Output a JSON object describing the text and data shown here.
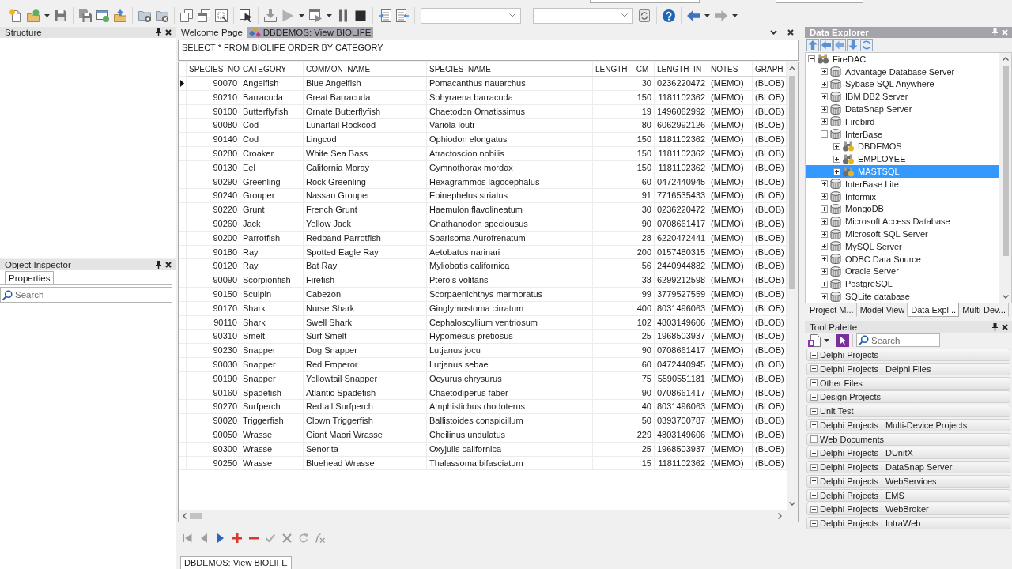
{
  "toolbar": {
    "groups": [
      {
        "buttons": [
          {
            "kind": "new_file",
            "disabled": false
          },
          {
            "kind": "open_folder",
            "disabled": false
          },
          {
            "kind": "menu_caret",
            "disabled": false
          },
          {
            "kind": "save",
            "disabled": false
          }
        ]
      },
      {
        "buttons": [
          {
            "kind": "save_all",
            "disabled": false
          },
          {
            "kind": "window_add",
            "disabled": false
          },
          {
            "kind": "folder_up",
            "disabled": false
          }
        ]
      },
      {
        "buttons": [
          {
            "kind": "folder_gear",
            "disabled": false
          },
          {
            "kind": "folder_remove",
            "disabled": false
          }
        ]
      },
      {
        "buttons": [
          {
            "kind": "page",
            "disabled": false
          },
          {
            "kind": "windows",
            "disabled": false
          },
          {
            "kind": "page_view",
            "disabled": false
          }
        ]
      },
      {
        "buttons": [
          {
            "kind": "toggle_form",
            "disabled": false
          }
        ]
      },
      {
        "buttons": [
          {
            "kind": "download",
            "disabled": false
          },
          {
            "kind": "run",
            "disabled": true
          },
          {
            "kind": "menu_caret",
            "disabled": false
          },
          {
            "kind": "run_window",
            "disabled": false
          },
          {
            "kind": "menu_caret",
            "disabled": false
          },
          {
            "kind": "pause",
            "disabled": false
          },
          {
            "kind": "stop",
            "disabled": false
          }
        ]
      },
      {
        "buttons": [
          {
            "kind": "list_left",
            "disabled": false
          },
          {
            "kind": "list_right",
            "disabled": false
          }
        ]
      },
      {
        "buttons": [
          {
            "kind": "combo",
            "disabled": false
          }
        ]
      },
      {
        "buttons": [
          {
            "kind": "combo",
            "disabled": false
          },
          {
            "kind": "page_sync",
            "disabled": false
          }
        ]
      },
      {
        "buttons": [
          {
            "kind": "help",
            "disabled": false
          }
        ]
      },
      {
        "buttons": [
          {
            "kind": "back",
            "disabled": false
          },
          {
            "kind": "menu_caret",
            "disabled": false
          },
          {
            "kind": "forward",
            "disabled": true
          },
          {
            "kind": "menu_caret",
            "disabled": false
          }
        ]
      }
    ]
  },
  "structure_panel": {
    "title": "Structure",
    "active": false
  },
  "object_inspector": {
    "title": "Object Inspector",
    "active": false,
    "tabs": [
      {
        "label": "Properties",
        "selected": true
      }
    ],
    "search": {
      "placeholder": "Search"
    }
  },
  "editor": {
    "tabs": [
      {
        "label": "Welcome Page",
        "kind": "welcome",
        "selected": false
      },
      {
        "label": "DBDEMOS: View BIOLIFE",
        "kind": "data_view",
        "selected": true
      }
    ],
    "sql": "SELECT * FROM BIOLIFE ORDER BY CATEGORY",
    "grid": {
      "columns": [
        "SPECIES_NO",
        "CATEGORY",
        "COMMON_NAME",
        "SPECIES_NAME",
        "LENGTH__CM_",
        "LENGTH_IN",
        "NOTES",
        "GRAPH"
      ],
      "rows": [
        {
          "selected": true,
          "cells": [
            "90070",
            "Angelfish",
            "Blue Angelfish",
            "Pomacanthus nauarchus",
            "30",
            "0236220472",
            "(MEMO)",
            "(BLOB)"
          ]
        },
        {
          "selected": false,
          "cells": [
            "90210",
            "Barracuda",
            "Great Barracuda",
            "Sphyraena barracuda",
            "150",
            "1181102362",
            "(MEMO)",
            "(BLOB)"
          ]
        },
        {
          "selected": false,
          "cells": [
            "90100",
            "Butterflyfish",
            "Ornate Butterflyfish",
            "Chaetodon Ornatissimus",
            "19",
            "1496062992",
            "(MEMO)",
            "(BLOB)"
          ]
        },
        {
          "selected": false,
          "cells": [
            "90080",
            "Cod",
            "Lunartail Rockcod",
            "Variola louti",
            "80",
            "6062992126",
            "(MEMO)",
            "(BLOB)"
          ]
        },
        {
          "selected": false,
          "cells": [
            "90140",
            "Cod",
            "Lingcod",
            "Ophiodon elongatus",
            "150",
            "1181102362",
            "(MEMO)",
            "(BLOB)"
          ]
        },
        {
          "selected": false,
          "cells": [
            "90280",
            "Croaker",
            "White Sea Bass",
            "Atractoscion nobilis",
            "150",
            "1181102362",
            "(MEMO)",
            "(BLOB)"
          ]
        },
        {
          "selected": false,
          "cells": [
            "90130",
            "Eel",
            "California Moray",
            "Gymnothorax mordax",
            "150",
            "1181102362",
            "(MEMO)",
            "(BLOB)"
          ]
        },
        {
          "selected": false,
          "cells": [
            "90290",
            "Greenling",
            "Rock Greenling",
            "Hexagrammos lagocephalus",
            "60",
            "0472440945",
            "(MEMO)",
            "(BLOB)"
          ]
        },
        {
          "selected": false,
          "cells": [
            "90240",
            "Grouper",
            "Nassau Grouper",
            "Epinephelus striatus",
            "91",
            "7716535433",
            "(MEMO)",
            "(BLOB)"
          ]
        },
        {
          "selected": false,
          "cells": [
            "90220",
            "Grunt",
            "French Grunt",
            "Haemulon flavolineatum",
            "30",
            "0236220472",
            "(MEMO)",
            "(BLOB)"
          ]
        },
        {
          "selected": false,
          "cells": [
            "90260",
            "Jack",
            "Yellow Jack",
            "Gnathanodon speciousus",
            "90",
            "0708661417",
            "(MEMO)",
            "(BLOB)"
          ]
        },
        {
          "selected": false,
          "cells": [
            "90200",
            "Parrotfish",
            "Redband Parrotfish",
            "Sparisoma Aurofrenatum",
            "28",
            "6220472441",
            "(MEMO)",
            "(BLOB)"
          ]
        },
        {
          "selected": false,
          "cells": [
            "90180",
            "Ray",
            "Spotted Eagle Ray",
            "Aetobatus narinari",
            "200",
            "0157480315",
            "(MEMO)",
            "(BLOB)"
          ]
        },
        {
          "selected": false,
          "cells": [
            "90120",
            "Ray",
            "Bat Ray",
            "Myliobatis californica",
            "56",
            "2440944882",
            "(MEMO)",
            "(BLOB)"
          ]
        },
        {
          "selected": false,
          "cells": [
            "90090",
            "Scorpionfish",
            "Firefish",
            "Pterois volitans",
            "38",
            "6299212598",
            "(MEMO)",
            "(BLOB)"
          ]
        },
        {
          "selected": false,
          "cells": [
            "90150",
            "Sculpin",
            "Cabezon",
            "Scorpaenichthys marmoratus",
            "99",
            "3779527559",
            "(MEMO)",
            "(BLOB)"
          ]
        },
        {
          "selected": false,
          "cells": [
            "90170",
            "Shark",
            "Nurse Shark",
            "Ginglymostoma cirratum",
            "400",
            "8031496063",
            "(MEMO)",
            "(BLOB)"
          ]
        },
        {
          "selected": false,
          "cells": [
            "90110",
            "Shark",
            "Swell Shark",
            "Cephaloscyllium ventriosum",
            "102",
            "4803149606",
            "(MEMO)",
            "(BLOB)"
          ]
        },
        {
          "selected": false,
          "cells": [
            "90310",
            "Smelt",
            "Surf Smelt",
            "Hypomesus pretiosus",
            "25",
            "1968503937",
            "(MEMO)",
            "(BLOB)"
          ]
        },
        {
          "selected": false,
          "cells": [
            "90230",
            "Snapper",
            "Dog Snapper",
            "Lutjanus jocu",
            "90",
            "0708661417",
            "(MEMO)",
            "(BLOB)"
          ]
        },
        {
          "selected": false,
          "cells": [
            "90030",
            "Snapper",
            "Red Emperor",
            "Lutjanus sebae",
            "60",
            "0472440945",
            "(MEMO)",
            "(BLOB)"
          ]
        },
        {
          "selected": false,
          "cells": [
            "90190",
            "Snapper",
            "Yellowtail Snapper",
            "Ocyurus chrysurus",
            "75",
            "5590551181",
            "(MEMO)",
            "(BLOB)"
          ]
        },
        {
          "selected": false,
          "cells": [
            "90160",
            "Spadefish",
            "Atlantic Spadefish",
            "Chaetodiperus faber",
            "90",
            "0708661417",
            "(MEMO)",
            "(BLOB)"
          ]
        },
        {
          "selected": false,
          "cells": [
            "90270",
            "Surfperch",
            "Redtail Surfperch",
            "Amphistichus rhodoterus",
            "40",
            "8031496063",
            "(MEMO)",
            "(BLOB)"
          ]
        },
        {
          "selected": false,
          "cells": [
            "90020",
            "Triggerfish",
            "Clown Triggerfish",
            "Ballistoides conspicillum",
            "50",
            "0393700787",
            "(MEMO)",
            "(BLOB)"
          ]
        },
        {
          "selected": false,
          "cells": [
            "90050",
            "Wrasse",
            "Giant Maori Wrasse",
            "Cheilinus undulatus",
            "229",
            "4803149606",
            "(MEMO)",
            "(BLOB)"
          ]
        },
        {
          "selected": false,
          "cells": [
            "90300",
            "Wrasse",
            "Senorita",
            "Oxyjulis californica",
            "25",
            "1968503937",
            "(MEMO)",
            "(BLOB)"
          ]
        },
        {
          "selected": false,
          "cells": [
            "90250",
            "Wrasse",
            "Bluehead Wrasse",
            "Thalassoma bifasciatum",
            "15",
            "1181102362",
            "(MEMO)",
            "(BLOB)"
          ]
        }
      ]
    },
    "navigator": [
      {
        "kind": "first",
        "disabled": true
      },
      {
        "kind": "prior",
        "disabled": true
      },
      {
        "kind": "next",
        "disabled": false
      },
      {
        "kind": "insert",
        "disabled": false
      },
      {
        "kind": "delete",
        "disabled": false
      },
      {
        "kind": "post",
        "disabled": true
      },
      {
        "kind": "cancel",
        "disabled": true
      },
      {
        "kind": "refresh",
        "disabled": true
      },
      {
        "kind": "cancel_updates",
        "disabled": true
      }
    ],
    "bottom_tabs": [
      {
        "label": "DBDEMOS: View BIOLIFE",
        "selected": true
      }
    ]
  },
  "data_explorer": {
    "title": "Data Explorer",
    "active": true,
    "tree": [
      {
        "label": "FireDAC",
        "kind": "root",
        "expanded": true,
        "selected": false,
        "children": [
          {
            "label": "Advantage Database Server",
            "kind": "driver",
            "expanded": false,
            "selected": false
          },
          {
            "label": "Sybase SQL Anywhere",
            "kind": "driver",
            "expanded": false,
            "selected": false
          },
          {
            "label": "IBM DB2 Server",
            "kind": "driver",
            "expanded": false,
            "selected": false
          },
          {
            "label": "DataSnap Server",
            "kind": "driver",
            "expanded": false,
            "selected": false
          },
          {
            "label": "Firebird",
            "kind": "driver",
            "expanded": false,
            "selected": false
          },
          {
            "label": "InterBase",
            "kind": "driver",
            "expanded": true,
            "selected": false,
            "children": [
              {
                "label": "DBDEMOS",
                "kind": "connection",
                "expanded": false,
                "selected": false
              },
              {
                "label": "EMPLOYEE",
                "kind": "connection",
                "expanded": false,
                "selected": false
              },
              {
                "label": "MASTSQL",
                "kind": "connection",
                "expanded": false,
                "selected": true
              }
            ]
          },
          {
            "label": "InterBase Lite",
            "kind": "driver",
            "expanded": false,
            "selected": false
          },
          {
            "label": "Informix",
            "kind": "driver",
            "expanded": false,
            "selected": false
          },
          {
            "label": "MongoDB",
            "kind": "driver",
            "expanded": false,
            "selected": false
          },
          {
            "label": "Microsoft Access Database",
            "kind": "driver",
            "expanded": false,
            "selected": false
          },
          {
            "label": "Microsoft SQL Server",
            "kind": "driver",
            "expanded": false,
            "selected": false
          },
          {
            "label": "MySQL Server",
            "kind": "driver",
            "expanded": false,
            "selected": false
          },
          {
            "label": "ODBC Data Source",
            "kind": "driver",
            "expanded": false,
            "selected": false
          },
          {
            "label": "Oracle Server",
            "kind": "driver",
            "expanded": false,
            "selected": false
          },
          {
            "label": "PostgreSQL",
            "kind": "driver",
            "expanded": false,
            "selected": false
          },
          {
            "label": "SQLite database",
            "kind": "driver",
            "expanded": false,
            "selected": false
          }
        ]
      }
    ],
    "tabs": [
      {
        "label": "Project M...",
        "selected": false
      },
      {
        "label": "Model View",
        "selected": false
      },
      {
        "label": "Data Expl...",
        "selected": true
      },
      {
        "label": "Multi-Dev...",
        "selected": false
      }
    ]
  },
  "tool_palette": {
    "title": "Tool Palette",
    "active": false,
    "search": {
      "placeholder": "Search"
    },
    "categories": [
      {
        "label": "Delphi Projects",
        "expanded": false
      },
      {
        "label": "Delphi Projects | Delphi Files",
        "expanded": false
      },
      {
        "label": "Other Files",
        "expanded": false
      },
      {
        "label": "Design Projects",
        "expanded": false
      },
      {
        "label": "Unit Test",
        "expanded": false
      },
      {
        "label": "Delphi Projects | Multi-Device Projects",
        "expanded": false
      },
      {
        "label": "Web Documents",
        "expanded": false
      },
      {
        "label": "Delphi Projects | DUnitX",
        "expanded": false
      },
      {
        "label": "Delphi Projects | DataSnap Server",
        "expanded": false
      },
      {
        "label": "Delphi Projects | WebServices",
        "expanded": false
      },
      {
        "label": "Delphi Projects | EMS",
        "expanded": false
      },
      {
        "label": "Delphi Projects | WebBroker",
        "expanded": false
      },
      {
        "label": "Delphi Projects | IntraWeb",
        "expanded": false
      }
    ]
  }
}
